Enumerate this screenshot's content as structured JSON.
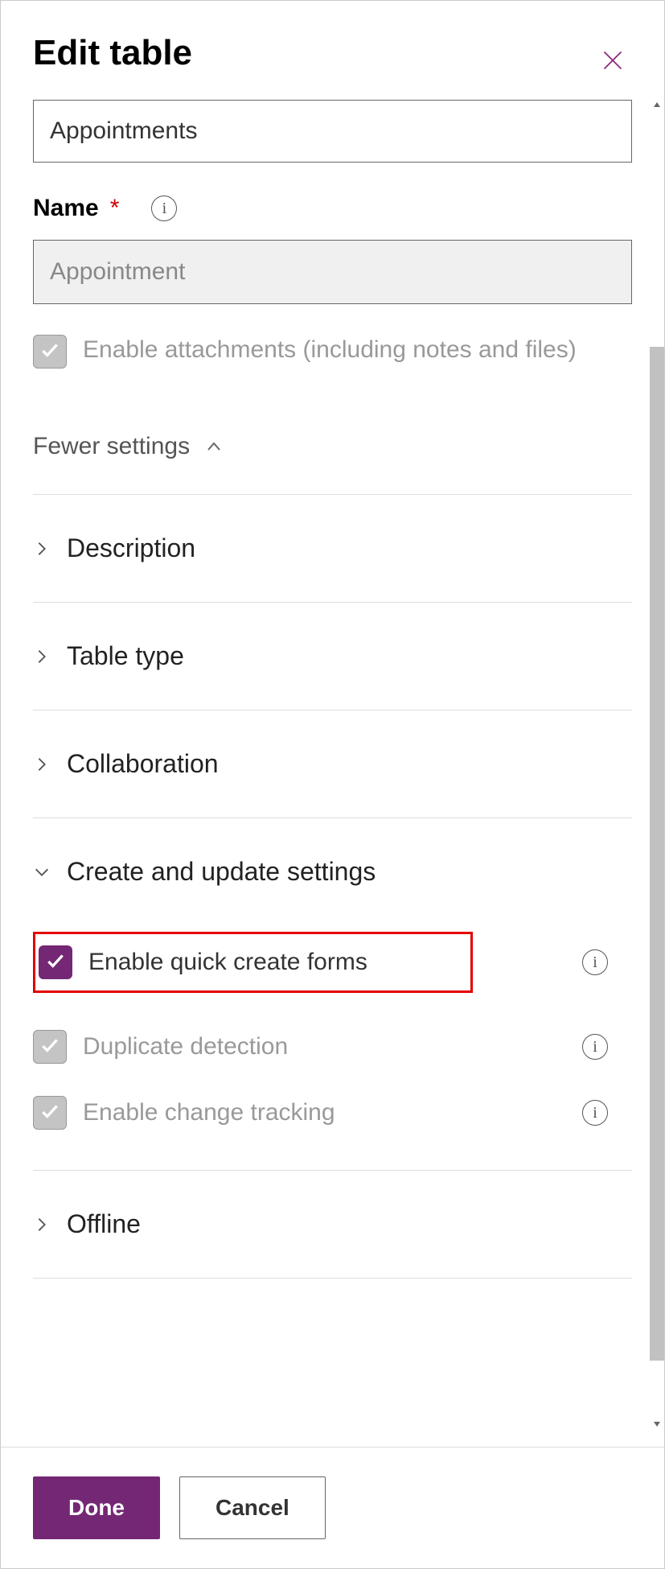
{
  "header": {
    "title": "Edit table"
  },
  "fields": {
    "display_name_value": "Appointments",
    "name_label": "Name",
    "name_value": "Appointment",
    "enable_attachments_label": "Enable attachments (including notes and files)"
  },
  "fewer_settings_label": "Fewer settings",
  "sections": {
    "description": "Description",
    "table_type": "Table type",
    "collaboration": "Collaboration",
    "create_update": "Create and update settings",
    "offline": "Offline"
  },
  "options": {
    "enable_quick_create": "Enable quick create forms",
    "duplicate_detection": "Duplicate detection",
    "enable_change_tracking": "Enable change tracking"
  },
  "footer": {
    "done": "Done",
    "cancel": "Cancel"
  }
}
